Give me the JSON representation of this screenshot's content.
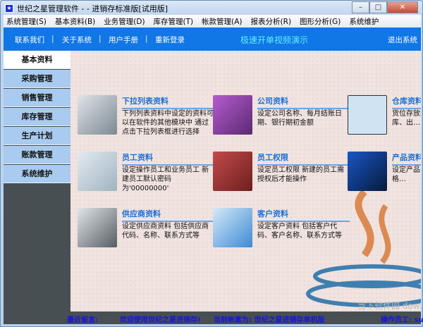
{
  "window": {
    "title": "世纪之星管理软件 -  - 进销存标准版[试用版]",
    "minimize": "–",
    "maximize": "□",
    "close": "✕"
  },
  "menu": [
    "系统管理(S)",
    "基本资料(B)",
    "业务管理(D)",
    "库存管理(T)",
    "帐款管理(A)",
    "报表分析(R)",
    "图形分析(G)",
    "系统维护"
  ],
  "toolbar": {
    "contact": "联系我们",
    "about": "关于系统",
    "manual": "用户手册",
    "relogin": "重新登录",
    "video": "极速开单视频演示",
    "exit": "退出系统",
    "separator": "|"
  },
  "sidebar": [
    {
      "label": "基本资料"
    },
    {
      "label": "采购管理"
    },
    {
      "label": "销售管理"
    },
    {
      "label": "库存管理"
    },
    {
      "label": "生产计划"
    },
    {
      "label": "账款管理"
    },
    {
      "label": "系统维护"
    }
  ],
  "cards": [
    {
      "title": "下拉列表资料",
      "desc": "下列列表资料中设定的资料可以在软件的其他模块中 通过点击下拉列表框进行选择"
    },
    {
      "title": "公司资料",
      "desc": "设定公司名称、每月结账日期、银行期初金额"
    },
    {
      "title": "仓库资料",
      "desc": "货位存放的…是虚拟的…入库、出…"
    },
    {
      "title": "员工资料",
      "desc": "设定操作员工和业务员工 新建员工默认密码为'00000000'"
    },
    {
      "title": "员工权限",
      "desc": "设定员工权限 新建的员工需授权后才能操作"
    },
    {
      "title": "产品资料",
      "desc": "设定产品…产品代码…指导价格…"
    },
    {
      "title": "供应商资料",
      "desc": "设定供应商资料 包括供应商代码、名称、联系方式等"
    },
    {
      "title": "客户资料",
      "desc": "设定客户资料 包括客户代码、客户名称、联系方式等"
    }
  ],
  "status": {
    "msg_label": "最近留言:",
    "msg": "欢迎使用世纪之星进销存!",
    "account": "当前帐套为: 世纪之星进销存单机版",
    "operator": "操作员工: su"
  },
  "watermark": "当下软件园 downxia.com"
}
